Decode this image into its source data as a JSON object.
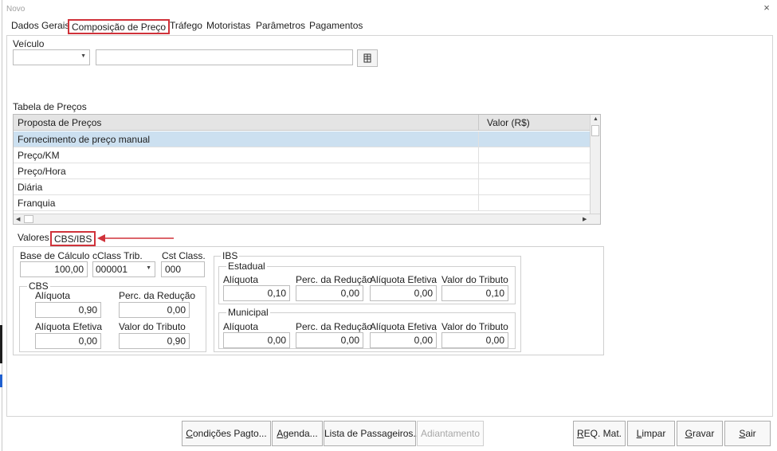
{
  "window": {
    "title": "Novo",
    "close_glyph": "×"
  },
  "tabs": [
    {
      "label": "Dados Gerais"
    },
    {
      "label": "Composição de Preço",
      "active": true
    },
    {
      "label": "Tráfego"
    },
    {
      "label": "Motoristas"
    },
    {
      "label": "Parâmetros"
    },
    {
      "label": "Pagamentos"
    }
  ],
  "veiculo": {
    "label": "Veículo",
    "combo_value": "",
    "description_value": "",
    "lookup_icon": "grid-icon"
  },
  "tabela_precos": {
    "label": "Tabela de Preços",
    "columns": [
      "Proposta de Preços",
      "Valor (R$)"
    ],
    "rows": [
      {
        "proposta": "Fornecimento de preço manual",
        "valor": "",
        "selected": true
      },
      {
        "proposta": "Preço/KM",
        "valor": ""
      },
      {
        "proposta": "Preço/Hora",
        "valor": ""
      },
      {
        "proposta": "Diária",
        "valor": ""
      },
      {
        "proposta": "Franquia",
        "valor": ""
      }
    ]
  },
  "subtabs": [
    {
      "label": "Valores"
    },
    {
      "label": "CBS/IBS",
      "active": true
    }
  ],
  "cbs_ibs": {
    "base_calculo": {
      "label": "Base de Cálculo",
      "value": "100,00"
    },
    "cclass_trib": {
      "label": "cClass Trib.",
      "value": "000001"
    },
    "cst_class": {
      "label": "Cst Class.",
      "value": "000"
    },
    "cbs": {
      "legend": "CBS",
      "aliquota": {
        "label": "Alíquota",
        "value": "0,90"
      },
      "perc_reducao": {
        "label": "Perc. da Redução",
        "value": "0,00"
      },
      "aliquota_efetiva": {
        "label": "Alíquota Efetiva",
        "value": "0,00"
      },
      "valor_tributo": {
        "label": "Valor do Tributo",
        "value": "0,90"
      }
    },
    "ibs": {
      "legend": "IBS",
      "estadual": {
        "legend": "Estadual",
        "aliquota": {
          "label": "Alíquota",
          "value": "0,10"
        },
        "perc_reducao": {
          "label": "Perc. da Redução",
          "value": "0,00"
        },
        "aliquota_efetiva": {
          "label": "Alíquota Efetiva",
          "value": "0,00"
        },
        "valor_tributo": {
          "label": "Valor do Tributo",
          "value": "0,10"
        }
      },
      "municipal": {
        "legend": "Municipal",
        "aliquota": {
          "label": "Alíquota",
          "value": "0,00"
        },
        "perc_reducao": {
          "label": "Perc. da Redução",
          "value": "0,00"
        },
        "aliquota_efetiva": {
          "label": "Alíquota Efetiva",
          "value": "0,00"
        },
        "valor_tributo": {
          "label": "Valor do Tributo",
          "value": "0,00"
        }
      }
    }
  },
  "buttons": {
    "condicoes": {
      "mnemonic": "C",
      "rest": "ondições Pagto..."
    },
    "agenda": {
      "mnemonic": "A",
      "rest": "genda..."
    },
    "passageiros": {
      "label": "Lista de Passageiros..."
    },
    "adiantamento": {
      "label": "Adiantamento"
    },
    "req_mat": {
      "mnemonic": "R",
      "rest": "EQ. Mat."
    },
    "limpar": {
      "mnemonic": "L",
      "rest": "impar"
    },
    "gravar": {
      "mnemonic": "G",
      "rest": "ravar"
    },
    "sair": {
      "mnemonic": "S",
      "rest": "air"
    }
  },
  "colors": {
    "highlight_red": "#d0323a",
    "selected_row": "#cce0f0",
    "annotation_arrow": "#d0323a"
  }
}
